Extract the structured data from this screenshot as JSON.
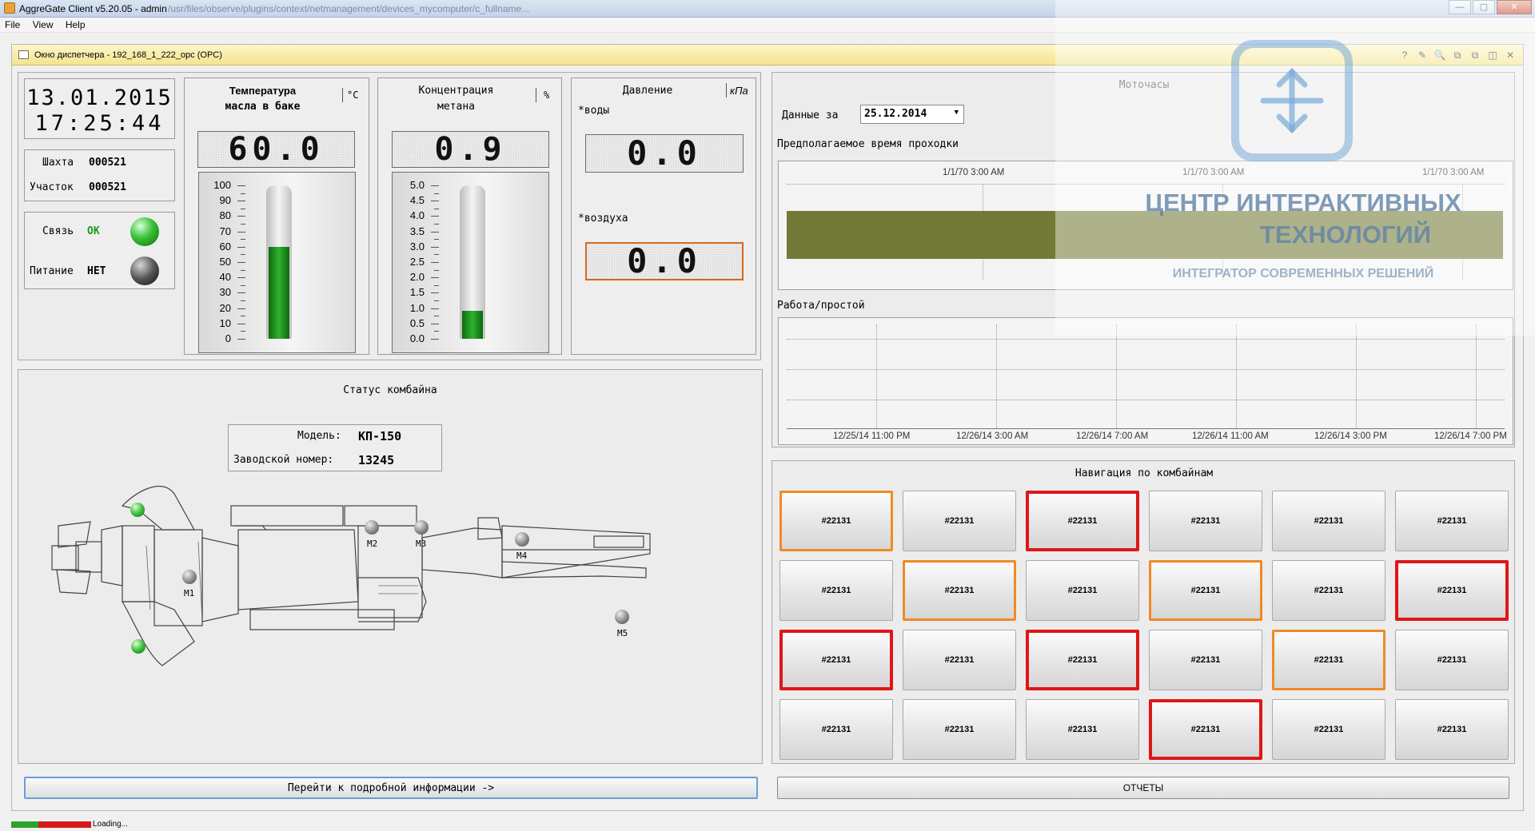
{
  "window": {
    "title": "AggreGate Client v5.20.05 - admin",
    "path": "/usr/files/observe/plugins/context/netmanagement/devices_mycomputer/c_fullname...",
    "controls": [
      "—",
      "▢",
      "✕"
    ]
  },
  "menu": [
    "File",
    "View",
    "Help"
  ],
  "frame": {
    "title": "Окно диспетчера - 192_168_1_222_opc (OPC)",
    "tools": [
      "?",
      "✎",
      "🔍",
      "⧉",
      "⧉",
      "◫",
      "✕"
    ]
  },
  "clock": {
    "date": "13.01.2015",
    "time": "17:25:44"
  },
  "location": {
    "mine_label": "Шахта",
    "mine_value": "000521",
    "section_label": "Участок",
    "section_value": "000521"
  },
  "status_leds": {
    "link_label": "Связь",
    "link_value": "ОК",
    "power_label": "Питание",
    "power_value": "НЕТ",
    "link_color": "#39c039",
    "power_color": "#333333"
  },
  "temperature": {
    "title_line1": "Температура",
    "title_line2": "масла в баке",
    "unit": "°C",
    "display": "60.0",
    "value": 60,
    "max": 100,
    "ticks": [
      "100",
      "90",
      "80",
      "70",
      "60",
      "50",
      "40",
      "30",
      "20",
      "10",
      "0"
    ]
  },
  "methane": {
    "title_line1": "Концентрация",
    "title_line2": "метана",
    "unit": "%",
    "display": "0.9",
    "value": 0.9,
    "max": 5,
    "ticks": [
      "5.0",
      "4.5",
      "4.0",
      "3.5",
      "3.0",
      "2.5",
      "2.0",
      "1.5",
      "1.0",
      "0.5",
      "0.0"
    ]
  },
  "pressure": {
    "title": "Давление",
    "unit": "кПа",
    "water_label": "*воды",
    "water_display": "0.0",
    "air_label": "*воздуха",
    "air_display": "0.0"
  },
  "combine_status": {
    "title": "Статус комбайна",
    "model_label": "Модель:",
    "model_value": "КП-150",
    "serial_label": "Заводской номер:",
    "serial_value": "13245",
    "motors": [
      "M1",
      "M2",
      "M3",
      "M4",
      "M5"
    ]
  },
  "details_button": "Перейти к подробной информации ->",
  "moto": {
    "title": "Моточасы",
    "date_label": "Данные за",
    "date_value": "25.12.2014",
    "planned_label": "Предполагаемое время проходки",
    "planned_ticks": [
      "1/1/70 3:00 AM",
      "1/1/70 3:00 AM",
      "1/1/70 3:00 AM"
    ],
    "bar_color": "#737a37",
    "work_label": "Работа/простой",
    "work_ticks": [
      "12/25/14 11:00 PM",
      "12/26/14 3:00 AM",
      "12/26/14 7:00 AM",
      "12/26/14 11:00 AM",
      "12/26/14 3:00 PM",
      "12/26/14 7:00 PM"
    ]
  },
  "navigation": {
    "title": "Навигация по комбайнам",
    "rows": [
      [
        {
          "label": "#22131",
          "state": "orange"
        },
        {
          "label": "#22131",
          "state": "normal"
        },
        {
          "label": "#22131",
          "state": "red"
        },
        {
          "label": "#22131",
          "state": "normal"
        },
        {
          "label": "#22131",
          "state": "normal"
        },
        {
          "label": "#22131",
          "state": "normal"
        }
      ],
      [
        {
          "label": "#22131",
          "state": "normal"
        },
        {
          "label": "#22131",
          "state": "orange"
        },
        {
          "label": "#22131",
          "state": "normal"
        },
        {
          "label": "#22131",
          "state": "orange"
        },
        {
          "label": "#22131",
          "state": "normal"
        },
        {
          "label": "#22131",
          "state": "red"
        }
      ],
      [
        {
          "label": "#22131",
          "state": "red"
        },
        {
          "label": "#22131",
          "state": "normal"
        },
        {
          "label": "#22131",
          "state": "red"
        },
        {
          "label": "#22131",
          "state": "normal"
        },
        {
          "label": "#22131",
          "state": "orange"
        },
        {
          "label": "#22131",
          "state": "normal"
        }
      ],
      [
        {
          "label": "#22131",
          "state": "normal"
        },
        {
          "label": "#22131",
          "state": "normal"
        },
        {
          "label": "#22131",
          "state": "normal"
        },
        {
          "label": "#22131",
          "state": "red"
        },
        {
          "label": "#22131",
          "state": "normal"
        },
        {
          "label": "#22131",
          "state": "normal"
        }
      ]
    ]
  },
  "reports_button": "ОТЧЕТЫ",
  "statusbar": {
    "text": "Loading..."
  },
  "watermark": {
    "line1": "ЦЕНТР ИНТЕРАКТИВНЫХ",
    "line2": "ТЕХНОЛОГИЙ",
    "line3": "ИНТЕГРАТОР СОВРЕМЕННЫХ РЕШЕНИЙ"
  }
}
